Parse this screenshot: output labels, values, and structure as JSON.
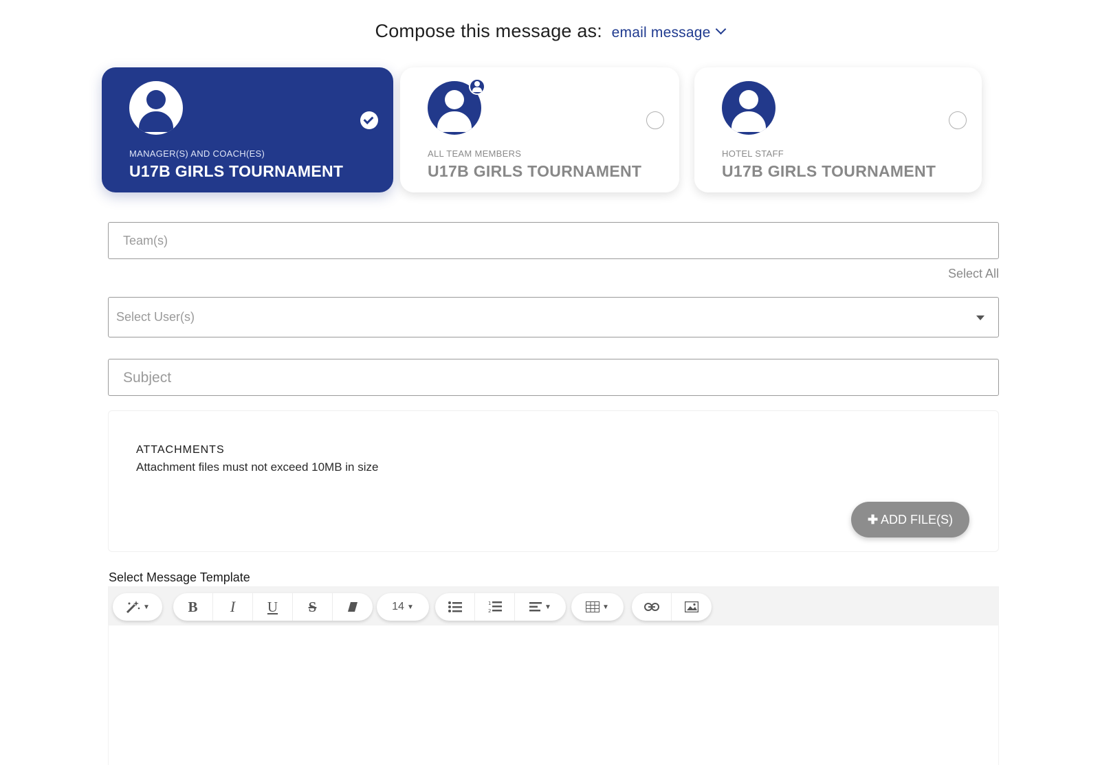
{
  "header": {
    "prefix": "Compose this message as:",
    "mode_value": "email message"
  },
  "recipient_cards": [
    {
      "subtitle": "MANAGER(S) AND COACH(ES)",
      "title": "U17B GIRLS TOURNAMENT",
      "selected": true
    },
    {
      "subtitle": "ALL TEAM MEMBERS",
      "title": "U17B GIRLS TOURNAMENT",
      "selected": false
    },
    {
      "subtitle": "HOTEL STAFF",
      "title": "U17B GIRLS TOURNAMENT",
      "selected": false
    }
  ],
  "teams_field": {
    "placeholder": "Team(s)",
    "select_all": "Select All"
  },
  "users_field": {
    "placeholder": "Select User(s)"
  },
  "subject_field": {
    "placeholder": "Subject"
  },
  "attachments": {
    "title": "ATTACHMENTS",
    "note": "Attachment files must not exceed 10MB in size",
    "add_button": "ADD FILE(S)"
  },
  "template": {
    "label": "Select Message Template"
  },
  "toolbar": {
    "bold": "B",
    "italic": "I",
    "underline": "U",
    "strike": "S",
    "font_size": "14"
  },
  "colors": {
    "accent": "#22398b",
    "button_gray": "#8d8d8d"
  }
}
